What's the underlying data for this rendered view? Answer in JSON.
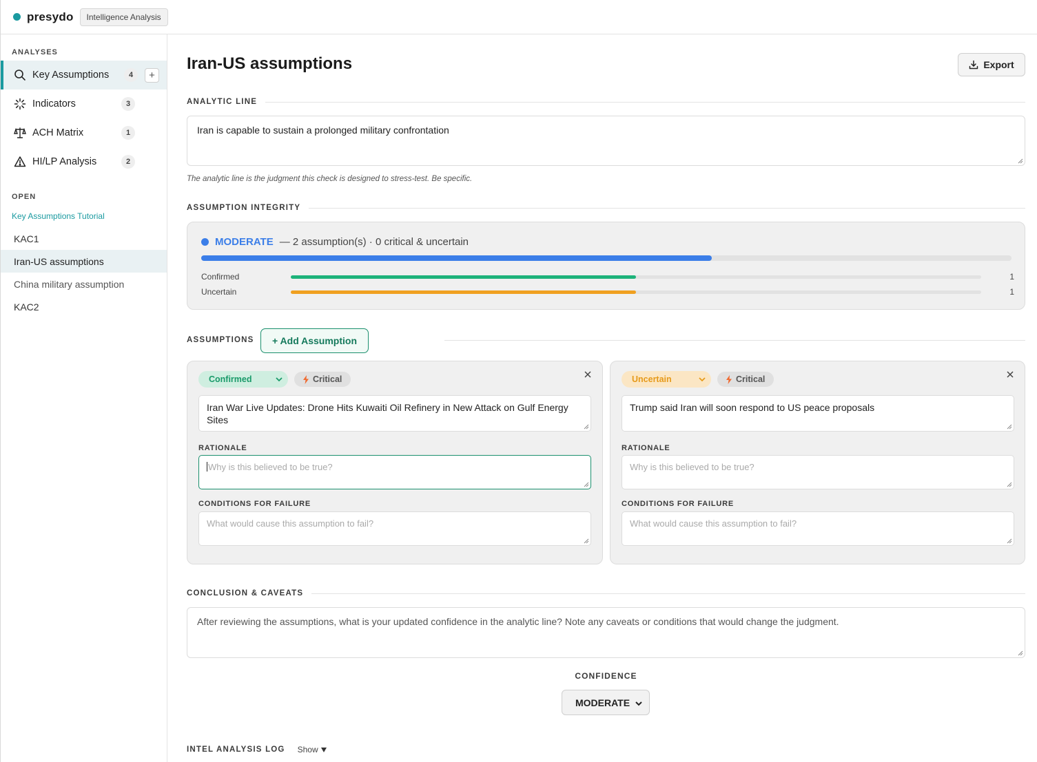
{
  "brand": {
    "name": "presydo",
    "badge": "Intelligence Analysis"
  },
  "sidebar": {
    "analyses_heading": "ANALYSES",
    "items": [
      {
        "label": "Key Assumptions",
        "count": "4",
        "icon": "search-icon",
        "active": true
      },
      {
        "label": "Indicators",
        "count": "3",
        "icon": "sparkle-icon"
      },
      {
        "label": "ACH Matrix",
        "count": "1",
        "icon": "scales-icon"
      },
      {
        "label": "HI/LP Analysis",
        "count": "2",
        "icon": "warning-icon"
      }
    ],
    "add_label": "+",
    "open_heading": "OPEN",
    "tutorial": "Key Assumptions Tutorial",
    "open_items": [
      "KAC1",
      "Iran-US assumptions",
      "China military assumption",
      "KAC2"
    ]
  },
  "main": {
    "title": "Iran-US assumptions",
    "export_label": "Export",
    "analytic_line_heading": "ANALYTIC LINE",
    "analytic_line_value": "Iran is capable to sustain a prolonged military confrontation",
    "analytic_line_hint": "The analytic line is the judgment this check is designed to stress-test. Be specific.",
    "integrity_heading": "ASSUMPTION INTEGRITY",
    "integrity": {
      "level": "MODERATE",
      "summary": "— 2 assumption(s) · 0 critical & uncertain",
      "score": 0.63,
      "color": "#3b7ee8",
      "rows": [
        {
          "label": "Confirmed",
          "count": "1",
          "fraction": 0.5,
          "color": "#1db37a"
        },
        {
          "label": "Uncertain",
          "count": "1",
          "fraction": 0.5,
          "color": "#f0a020"
        }
      ]
    },
    "assumptions_heading": "ASSUMPTIONS",
    "add_assumption_label": "+ Add Assumption",
    "cards": [
      {
        "status": "Confirmed",
        "status_bg": "#cfeee0",
        "status_color": "#1a9a6a",
        "critical": "Critical",
        "text": "Iran War Live Updates: Drone Hits Kuwaiti Oil Refinery in New Attack on Gulf Energy Sites",
        "rationale_label": "RATIONALE",
        "rationale_placeholder": "Why is this believed to be true?",
        "failure_label": "CONDITIONS FOR FAILURE",
        "failure_placeholder": "What would cause this assumption to fail?"
      },
      {
        "status": "Uncertain",
        "status_bg": "#fbe6c4",
        "status_color": "#e69a1a",
        "critical": "Critical",
        "text": "Trump said Iran will soon respond to US peace proposals",
        "rationale_label": "RATIONALE",
        "rationale_placeholder": "Why is this believed to be true?",
        "failure_label": "CONDITIONS FOR FAILURE",
        "failure_placeholder": "What would cause this assumption to fail?"
      }
    ],
    "conclusion_heading": "CONCLUSION & CAVEATS",
    "conclusion_placeholder": "After reviewing the assumptions, what is your updated confidence in the analytic line? Note any caveats or conditions that would change the judgment.",
    "confidence_label": "CONFIDENCE",
    "confidence_value": "MODERATE",
    "log_heading": "INTEL ANALYSIS LOG",
    "log_toggle": "Show"
  }
}
